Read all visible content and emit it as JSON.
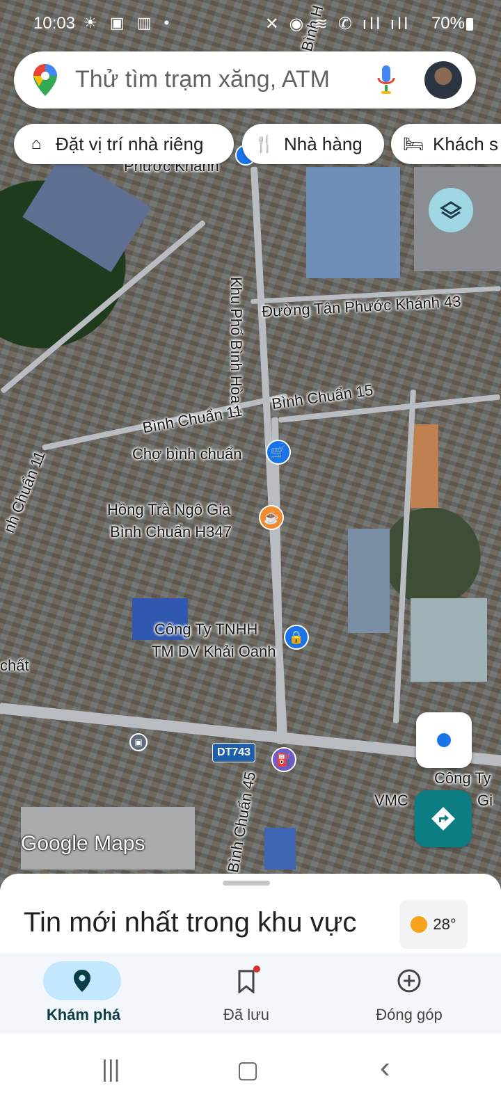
{
  "status_bar": {
    "time": "10:03",
    "left_icons": "☀ ▣ ▥ •",
    "right_icons": "✕ ◉ ≋ ✆ ıll ıll",
    "battery": "70%"
  },
  "search": {
    "placeholder": "Thử tìm trạm xăng, ATM",
    "mic_icon": "mic-icon",
    "maps_icon": "maps-pin-icon"
  },
  "chips": [
    {
      "label": "Đặt vị trí nhà riêng",
      "icon": "home-icon"
    },
    {
      "label": "Nhà hàng",
      "icon": "restaurant-icon"
    },
    {
      "label": "Khách s",
      "icon": "hotel-icon"
    }
  ],
  "map": {
    "labels": {
      "partial_top": "Phước Khánh",
      "top_right_street": "Bình H",
      "tan_phuoc_khanh": "Đường Tân Phước Khánh 43",
      "khu_pho": "Khu Phố Bình Hòa 1",
      "binh_chuan_15": "Bình Chuẩn 15",
      "binh_chuan_11": "Bình Chuẩn 11",
      "binh_chuan_11_left": "nh Chuẩn 11",
      "cho": "Chợ bình chuẩn",
      "hong_tra_1": "Hồng Trà Ngô Gia",
      "hong_tra_2": "Bình Chuẩn H347",
      "cong_ty_1": "Công Ty TNHH",
      "cong_ty_2": "TM DV Khải Oanh",
      "chat": "chất",
      "dt743": "DT743",
      "binh_chuan_45": "Bình Chuẩn 45",
      "cong_ty_right_1": "Công Ty",
      "cong_ty_right_2": "VMC",
      "cong_ty_right_3": "Gi",
      "logo": "Google Maps"
    }
  },
  "sheet": {
    "title": "Tin mới nhất trong khu vực",
    "temperature": "28°"
  },
  "bottom_nav": [
    {
      "label": "Khám phá",
      "icon": "explore-pin-icon",
      "active": true
    },
    {
      "label": "Đã lưu",
      "icon": "bookmark-icon",
      "active": false
    },
    {
      "label": "Đóng góp",
      "icon": "add-circle-icon",
      "active": false
    }
  ],
  "system_nav": {
    "recents": "|||",
    "home": "▢",
    "back": "‹"
  },
  "colors": {
    "accent": "#0b7d83",
    "active_pill": "#c2e7ff",
    "search_bg": "#ffffff"
  }
}
